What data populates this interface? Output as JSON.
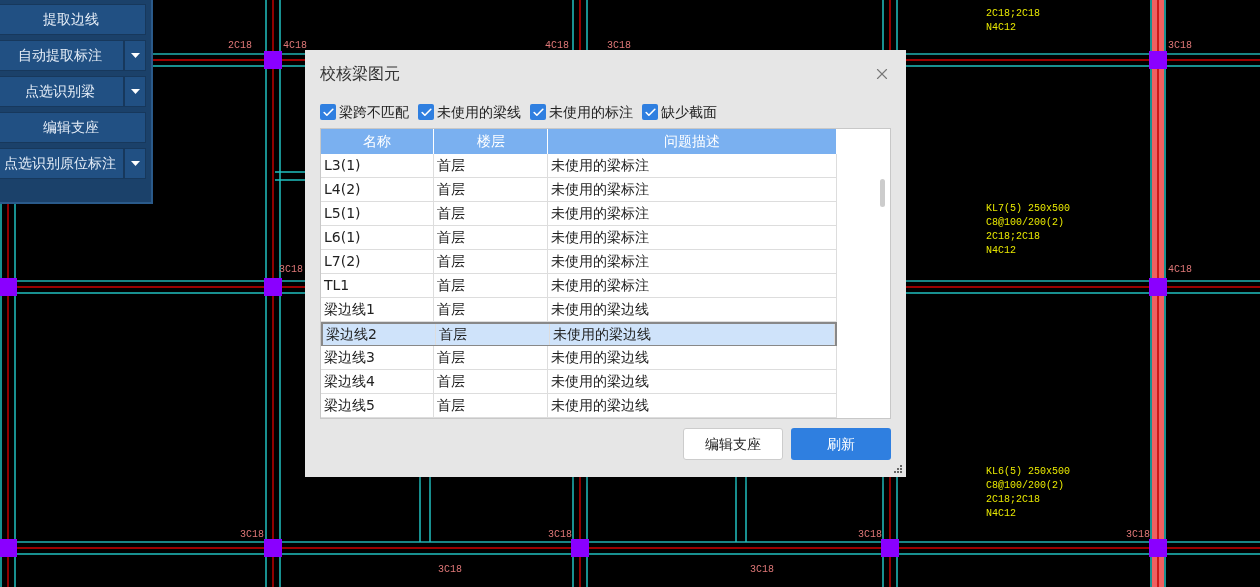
{
  "toolbar": {
    "buttons": [
      {
        "label": "提取边线",
        "has_dropdown": false
      },
      {
        "label": "自动提取标注",
        "has_dropdown": true
      },
      {
        "label": "点选识别梁",
        "has_dropdown": true
      },
      {
        "label": "编辑支座",
        "has_dropdown": false
      },
      {
        "label": "点选识别原位标注",
        "has_dropdown": true
      }
    ]
  },
  "drawing": {
    "labels": [
      {
        "text": "2C18"
      },
      {
        "text": "4C18"
      },
      {
        "text": "4C18"
      },
      {
        "text": "3C18"
      },
      {
        "text": "3C18"
      },
      {
        "text": "3C18"
      },
      {
        "text": "4C18"
      },
      {
        "text": "3C18"
      },
      {
        "text": "3C18"
      },
      {
        "text": "3C18"
      },
      {
        "text": "3C18"
      },
      {
        "text": "3C18"
      },
      {
        "text": "3C18"
      }
    ],
    "annotations": [
      {
        "lines": [
          "2C18;2C18",
          "N4C12"
        ]
      },
      {
        "lines": [
          "KL7(5) 250x500",
          "C8@100/200(2)",
          "2C18;2C18",
          "N4C12"
        ]
      },
      {
        "lines": [
          "KL6(5) 250x500",
          "C8@100/200(2)",
          "2C18;2C18",
          "N4C12"
        ]
      }
    ]
  },
  "dialog": {
    "title": "校核梁图元",
    "filters": [
      {
        "label": "梁跨不匹配",
        "checked": true
      },
      {
        "label": "未使用的梁线",
        "checked": true
      },
      {
        "label": "未使用的标注",
        "checked": true
      },
      {
        "label": "缺少截面",
        "checked": true
      }
    ],
    "table": {
      "columns": [
        "名称",
        "楼层",
        "问题描述"
      ],
      "rows": [
        {
          "cells": [
            "L3(1)",
            "首层",
            "未使用的梁标注"
          ],
          "selected": false
        },
        {
          "cells": [
            "L4(2)",
            "首层",
            "未使用的梁标注"
          ],
          "selected": false
        },
        {
          "cells": [
            "L5(1)",
            "首层",
            "未使用的梁标注"
          ],
          "selected": false
        },
        {
          "cells": [
            "L6(1)",
            "首层",
            "未使用的梁标注"
          ],
          "selected": false
        },
        {
          "cells": [
            "L7(2)",
            "首层",
            "未使用的梁标注"
          ],
          "selected": false
        },
        {
          "cells": [
            "TL1",
            "首层",
            "未使用的梁标注"
          ],
          "selected": false
        },
        {
          "cells": [
            "梁边线1",
            "首层",
            "未使用的梁边线"
          ],
          "selected": false
        },
        {
          "cells": [
            "梁边线2",
            "首层",
            "未使用的梁边线"
          ],
          "selected": true
        },
        {
          "cells": [
            "梁边线3",
            "首层",
            "未使用的梁边线"
          ],
          "selected": false
        },
        {
          "cells": [
            "梁边线4",
            "首层",
            "未使用的梁边线"
          ],
          "selected": false
        },
        {
          "cells": [
            "梁边线5",
            "首层",
            "未使用的梁边线"
          ],
          "selected": false
        }
      ]
    },
    "buttons": [
      {
        "label": "编辑支座",
        "kind": "secondary"
      },
      {
        "label": "刷新",
        "kind": "primary"
      }
    ]
  }
}
